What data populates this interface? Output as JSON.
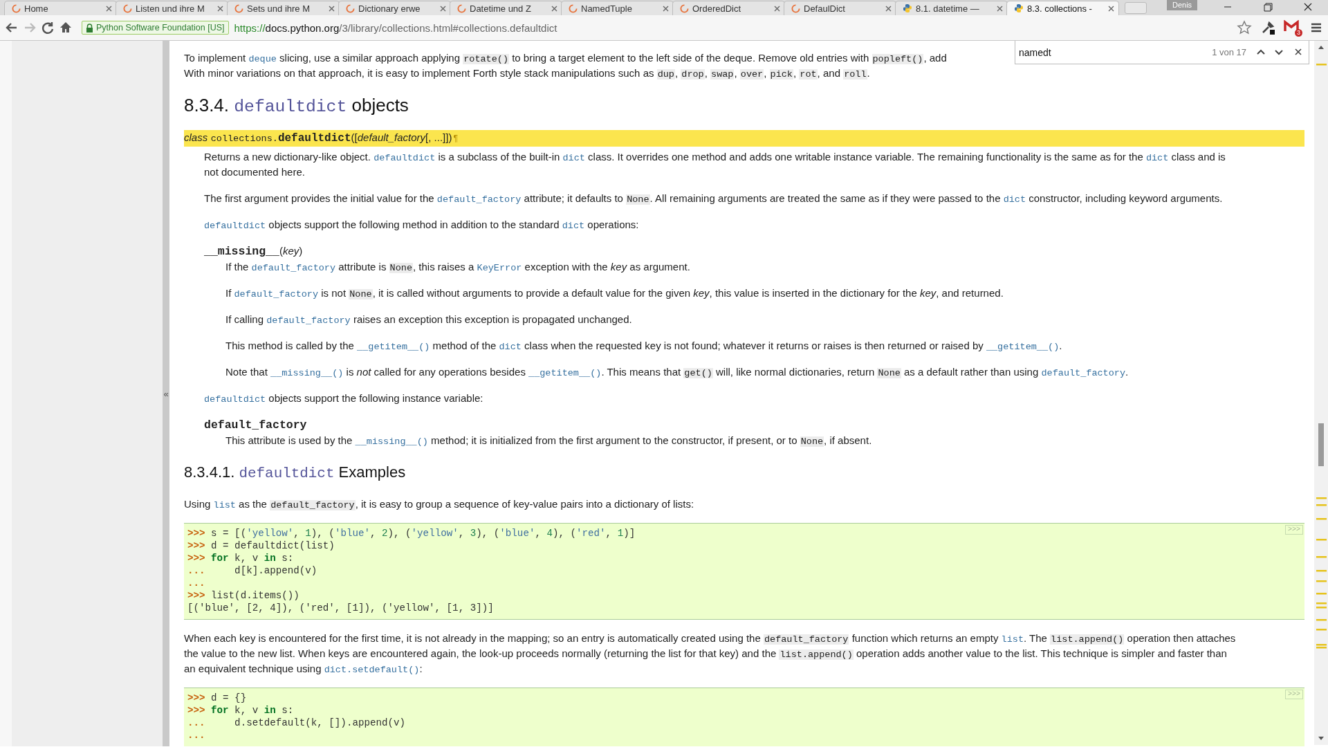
{
  "tabs": [
    {
      "title": "Home",
      "kind": "spinner",
      "selected": false
    },
    {
      "title": "Listen und ihre M",
      "kind": "spinner",
      "selected": false
    },
    {
      "title": "Sets und ihre M",
      "kind": "spinner",
      "selected": false
    },
    {
      "title": "Dictionary erwe",
      "kind": "spinner",
      "selected": false
    },
    {
      "title": "Datetime und Z",
      "kind": "spinner",
      "selected": false
    },
    {
      "title": "NamedTuple",
      "kind": "spinner",
      "selected": false
    },
    {
      "title": "OrderedDict",
      "kind": "spinner",
      "selected": false
    },
    {
      "title": "DefaulDict",
      "kind": "spinner",
      "selected": false
    },
    {
      "title": "8.1. datetime —",
      "kind": "python",
      "selected": false
    },
    {
      "title": "8.3. collections -",
      "kind": "python",
      "selected": true
    }
  ],
  "profile": "Denis",
  "nav_buttons": [
    {
      "kind": "back",
      "disabled": false
    },
    {
      "kind": "forward",
      "disabled": true
    },
    {
      "kind": "reload",
      "disabled": false
    },
    {
      "kind": "home",
      "disabled": false
    }
  ],
  "security": "Python Software Foundation [US]",
  "url": {
    "scheme": "https://",
    "host": "docs.python.org",
    "path": "/3/library/collections.html#collections.defaultdict"
  },
  "mail_count": "3",
  "find_bar": {
    "value": "namedt",
    "count": "1 von 17"
  },
  "sidebar": {
    "collapse": "«"
  },
  "content": [
    {
      "kind": "paragraph",
      "lines": [
        [
          {
            "kind": "text",
            "text": "To implement "
          },
          {
            "kind": "link",
            "text": "deque"
          },
          {
            "kind": "text",
            "text": " slicing, use a similar approach applying "
          },
          {
            "kind": "literal",
            "text": "rotate()"
          },
          {
            "kind": "text",
            "text": " to bring a target element to the left side of the deque. Remove old entries with "
          },
          {
            "kind": "literal",
            "text": "popleft()"
          },
          {
            "kind": "text",
            "text": ", add"
          }
        ],
        [
          {
            "kind": "text",
            "text": "With minor variations on that approach, it is easy to implement Forth style stack manipulations such as "
          },
          {
            "kind": "literal",
            "text": "dup"
          },
          {
            "kind": "text",
            "text": ", "
          },
          {
            "kind": "literal",
            "text": "drop"
          },
          {
            "kind": "text",
            "text": ", "
          },
          {
            "kind": "literal",
            "text": "swap"
          },
          {
            "kind": "text",
            "text": ", "
          },
          {
            "kind": "literal",
            "text": "over"
          },
          {
            "kind": "text",
            "text": ", "
          },
          {
            "kind": "literal",
            "text": "pick"
          },
          {
            "kind": "text",
            "text": ", "
          },
          {
            "kind": "literal",
            "text": "rot"
          },
          {
            "kind": "text",
            "text": ", and "
          },
          {
            "kind": "literal",
            "text": "roll"
          },
          {
            "kind": "text",
            "text": "."
          }
        ]
      ]
    },
    {
      "kind": "heading",
      "segments": [
        {
          "kind": "text",
          "text": "8.3.4. "
        },
        {
          "kind": "mono",
          "text": "defaultdict"
        },
        {
          "kind": "text",
          "text": " objects"
        }
      ]
    },
    {
      "kind": "class",
      "signature": [
        {
          "kind": "keyword",
          "text": "class"
        },
        {
          "kind": "mono",
          "text": "collections."
        },
        {
          "kind": "strong",
          "text": "defaultdict"
        },
        {
          "kind": "text",
          "text": "(["
        },
        {
          "kind": "em",
          "text": "default_factory"
        },
        {
          "kind": "text",
          "text": "[, ...]])"
        },
        {
          "kind": "pilcrow",
          "text": "¶"
        }
      ],
      "body": [
        {
          "kind": "paragraph",
          "lines": [
            [
              {
                "kind": "text",
                "text": "Returns a new dictionary-like object. "
              },
              {
                "kind": "link",
                "text": "defaultdict"
              },
              {
                "kind": "text",
                "text": " is a subclass of the built-in "
              },
              {
                "kind": "link",
                "text": "dict"
              },
              {
                "kind": "text",
                "text": " class. It overrides one method and adds one writable instance variable. The remaining functionality is the same as for the "
              },
              {
                "kind": "link",
                "text": "dict"
              },
              {
                "kind": "text",
                "text": " class and is"
              }
            ],
            [
              {
                "kind": "text",
                "text": "not documented here."
              }
            ]
          ]
        },
        {
          "kind": "paragraph",
          "lines": [
            [
              {
                "kind": "text",
                "text": "The first argument provides the initial value for the "
              },
              {
                "kind": "link",
                "text": "default_factory"
              },
              {
                "kind": "text",
                "text": " attribute; it defaults to "
              },
              {
                "kind": "literal",
                "text": "None"
              },
              {
                "kind": "text",
                "text": ". All remaining arguments are treated the same as if they were passed to the "
              },
              {
                "kind": "link",
                "text": "dict"
              },
              {
                "kind": "text",
                "text": " constructor, including keyword arguments."
              }
            ]
          ]
        },
        {
          "kind": "paragraph",
          "lines": [
            [
              {
                "kind": "link",
                "text": "defaultdict"
              },
              {
                "kind": "text",
                "text": " objects support the following method in addition to the standard "
              },
              {
                "kind": "link",
                "text": "dict"
              },
              {
                "kind": "text",
                "text": " operations:"
              }
            ]
          ]
        },
        {
          "kind": "method",
          "signature": [
            {
              "kind": "strong",
              "text": "__missing__"
            },
            {
              "kind": "text",
              "text": "("
            },
            {
              "kind": "em",
              "text": "key"
            },
            {
              "kind": "text",
              "text": ")"
            }
          ],
          "body": [
            {
              "kind": "paragraph",
              "lines": [
                [
                  {
                    "kind": "text",
                    "text": "If the "
                  },
                  {
                    "kind": "link",
                    "text": "default_factory"
                  },
                  {
                    "kind": "text",
                    "text": " attribute is "
                  },
                  {
                    "kind": "literal",
                    "text": "None"
                  },
                  {
                    "kind": "text",
                    "text": ", this raises a "
                  },
                  {
                    "kind": "link",
                    "text": "KeyError"
                  },
                  {
                    "kind": "text",
                    "text": " exception with the "
                  },
                  {
                    "kind": "em",
                    "text": "key"
                  },
                  {
                    "kind": "text",
                    "text": " as argument."
                  }
                ]
              ]
            },
            {
              "kind": "paragraph",
              "lines": [
                [
                  {
                    "kind": "text",
                    "text": "If "
                  },
                  {
                    "kind": "link",
                    "text": "default_factory"
                  },
                  {
                    "kind": "text",
                    "text": " is not "
                  },
                  {
                    "kind": "literal",
                    "text": "None"
                  },
                  {
                    "kind": "text",
                    "text": ", it is called without arguments to provide a default value for the given "
                  },
                  {
                    "kind": "em",
                    "text": "key"
                  },
                  {
                    "kind": "text",
                    "text": ", this value is inserted in the dictionary for the "
                  },
                  {
                    "kind": "em",
                    "text": "key"
                  },
                  {
                    "kind": "text",
                    "text": ", and returned."
                  }
                ]
              ]
            },
            {
              "kind": "paragraph",
              "lines": [
                [
                  {
                    "kind": "text",
                    "text": "If calling "
                  },
                  {
                    "kind": "link",
                    "text": "default_factory"
                  },
                  {
                    "kind": "text",
                    "text": " raises an exception this exception is propagated unchanged."
                  }
                ]
              ]
            },
            {
              "kind": "paragraph",
              "lines": [
                [
                  {
                    "kind": "text",
                    "text": "This method is called by the "
                  },
                  {
                    "kind": "link",
                    "text": "__getitem__()"
                  },
                  {
                    "kind": "text",
                    "text": " method of the "
                  },
                  {
                    "kind": "link",
                    "text": "dict"
                  },
                  {
                    "kind": "text",
                    "text": " class when the requested key is not found; whatever it returns or raises is then returned or raised by "
                  },
                  {
                    "kind": "link",
                    "text": "__getitem__()"
                  },
                  {
                    "kind": "text",
                    "text": "."
                  }
                ]
              ]
            },
            {
              "kind": "paragraph",
              "lines": [
                [
                  {
                    "kind": "text",
                    "text": "Note that "
                  },
                  {
                    "kind": "link",
                    "text": "__missing__()"
                  },
                  {
                    "kind": "text",
                    "text": " is "
                  },
                  {
                    "kind": "em",
                    "text": "not"
                  },
                  {
                    "kind": "text",
                    "text": " called for any operations besides "
                  },
                  {
                    "kind": "link",
                    "text": "__getitem__()"
                  },
                  {
                    "kind": "text",
                    "text": ". This means that "
                  },
                  {
                    "kind": "literal",
                    "text": "get()"
                  },
                  {
                    "kind": "text",
                    "text": " will, like normal dictionaries, return "
                  },
                  {
                    "kind": "literal",
                    "text": "None"
                  },
                  {
                    "kind": "text",
                    "text": " as a default rather than using "
                  },
                  {
                    "kind": "link",
                    "text": "default_factory"
                  },
                  {
                    "kind": "text",
                    "text": "."
                  }
                ]
              ]
            }
          ]
        },
        {
          "kind": "paragraph",
          "lines": [
            [
              {
                "kind": "link",
                "text": "defaultdict"
              },
              {
                "kind": "text",
                "text": " objects support the following instance variable:"
              }
            ]
          ]
        },
        {
          "kind": "attribute",
          "signature": [
            {
              "kind": "strong",
              "text": "default_factory"
            }
          ],
          "body": [
            {
              "kind": "paragraph",
              "lines": [
                [
                  {
                    "kind": "text",
                    "text": "This attribute is used by the "
                  },
                  {
                    "kind": "link",
                    "text": "__missing__()"
                  },
                  {
                    "kind": "text",
                    "text": " method; it is initialized from the first argument to the constructor, if present, or to "
                  },
                  {
                    "kind": "literal",
                    "text": "None"
                  },
                  {
                    "kind": "text",
                    "text": ", if absent."
                  }
                ]
              ]
            }
          ]
        }
      ]
    },
    {
      "kind": "subheading",
      "segments": [
        {
          "kind": "text",
          "text": "8.3.4.1. "
        },
        {
          "kind": "mono",
          "text": "defaultdict"
        },
        {
          "kind": "text",
          "text": " Examples"
        }
      ]
    },
    {
      "kind": "paragraph",
      "lines": [
        [
          {
            "kind": "text",
            "text": "Using "
          },
          {
            "kind": "link",
            "text": "list"
          },
          {
            "kind": "text",
            "text": " as the "
          },
          {
            "kind": "literal",
            "text": "default_factory"
          },
          {
            "kind": "text",
            "text": ", it is easy to group a sequence of key-value pairs into a dictionary of lists:"
          }
        ]
      ]
    },
    {
      "kind": "code",
      "copy_label": ">>>",
      "lines": [
        [
          {
            "kind": "prompt",
            "text": ">>> "
          },
          {
            "kind": "plain",
            "text": "s = [("
          },
          {
            "kind": "string",
            "text": "'yellow'"
          },
          {
            "kind": "plain",
            "text": ", "
          },
          {
            "kind": "number",
            "text": "1"
          },
          {
            "kind": "plain",
            "text": "), ("
          },
          {
            "kind": "string",
            "text": "'blue'"
          },
          {
            "kind": "plain",
            "text": ", "
          },
          {
            "kind": "number",
            "text": "2"
          },
          {
            "kind": "plain",
            "text": "), ("
          },
          {
            "kind": "string",
            "text": "'yellow'"
          },
          {
            "kind": "plain",
            "text": ", "
          },
          {
            "kind": "number",
            "text": "3"
          },
          {
            "kind": "plain",
            "text": "), ("
          },
          {
            "kind": "string",
            "text": "'blue'"
          },
          {
            "kind": "plain",
            "text": ", "
          },
          {
            "kind": "number",
            "text": "4"
          },
          {
            "kind": "plain",
            "text": "), ("
          },
          {
            "kind": "string",
            "text": "'red'"
          },
          {
            "kind": "plain",
            "text": ", "
          },
          {
            "kind": "number",
            "text": "1"
          },
          {
            "kind": "plain",
            "text": ")]"
          }
        ],
        [
          {
            "kind": "prompt",
            "text": ">>> "
          },
          {
            "kind": "plain",
            "text": "d = defaultdict(list)"
          }
        ],
        [
          {
            "kind": "prompt",
            "text": ">>> "
          },
          {
            "kind": "keyword",
            "text": "for"
          },
          {
            "kind": "plain",
            "text": " k, v "
          },
          {
            "kind": "keyword",
            "text": "in"
          },
          {
            "kind": "plain",
            "text": " s:"
          }
        ],
        [
          {
            "kind": "prompt",
            "text": "... "
          },
          {
            "kind": "plain",
            "text": "    d[k].append(v)"
          }
        ],
        [
          {
            "kind": "prompt",
            "text": "..."
          }
        ],
        [
          {
            "kind": "prompt",
            "text": ">>> "
          },
          {
            "kind": "plain",
            "text": "list(d.items())"
          }
        ],
        [
          {
            "kind": "output",
            "text": "[('blue', [2, 4]), ('red', [1]), ('yellow', [1, 3])]"
          }
        ]
      ]
    },
    {
      "kind": "paragraph",
      "lines": [
        [
          {
            "kind": "text",
            "text": "When each key is encountered for the first time, it is not already in the mapping; so an entry is automatically created using the "
          },
          {
            "kind": "literal",
            "text": "default_factory"
          },
          {
            "kind": "text",
            "text": " function which returns an empty "
          },
          {
            "kind": "link",
            "text": "list"
          },
          {
            "kind": "text",
            "text": ". The "
          },
          {
            "kind": "literal",
            "text": "list.append()"
          },
          {
            "kind": "text",
            "text": " operation then attaches"
          }
        ],
        [
          {
            "kind": "text",
            "text": "the value to the new list. When keys are encountered again, the look-up proceeds normally (returning the list for that key) and the "
          },
          {
            "kind": "literal",
            "text": "list.append()"
          },
          {
            "kind": "text",
            "text": " operation adds another value to the list. This technique is simpler and faster than"
          }
        ],
        [
          {
            "kind": "text",
            "text": "an equivalent technique using "
          },
          {
            "kind": "link",
            "text": "dict.setdefault()"
          },
          {
            "kind": "text",
            "text": ":"
          }
        ]
      ]
    },
    {
      "kind": "code",
      "copy_label": ">>>",
      "lines": [
        [
          {
            "kind": "prompt",
            "text": ">>> "
          },
          {
            "kind": "plain",
            "text": "d = {}"
          }
        ],
        [
          {
            "kind": "prompt",
            "text": ">>> "
          },
          {
            "kind": "keyword",
            "text": "for"
          },
          {
            "kind": "plain",
            "text": " k, v "
          },
          {
            "kind": "keyword",
            "text": "in"
          },
          {
            "kind": "plain",
            "text": " s:"
          }
        ],
        [
          {
            "kind": "prompt",
            "text": "... "
          },
          {
            "kind": "plain",
            "text": "    d.setdefault(k, []).append(v)"
          }
        ],
        [
          {
            "kind": "prompt",
            "text": "..."
          }
        ]
      ]
    }
  ]
}
